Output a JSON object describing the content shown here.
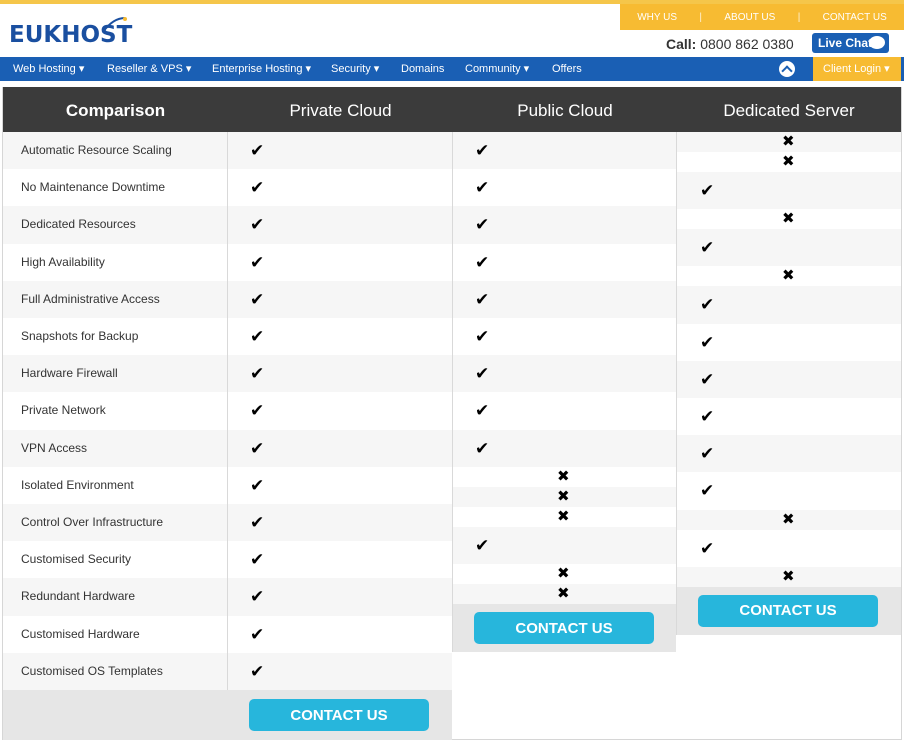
{
  "brand": {
    "logo_text": "EUKHOST"
  },
  "toplinks": [
    "WHY US",
    "ABOUT US",
    "CONTACT US"
  ],
  "call": {
    "label": "Call:",
    "number": "0800 862 0380"
  },
  "livechat": "Live Chat",
  "nav": [
    {
      "label": "Web Hosting",
      "caret": true
    },
    {
      "label": "Reseller & VPS",
      "caret": true
    },
    {
      "label": "Enterprise Hosting",
      "caret": true
    },
    {
      "label": "Security",
      "caret": true
    },
    {
      "label": "Domains",
      "caret": false
    },
    {
      "label": "Community",
      "caret": true
    },
    {
      "label": "Offers",
      "caret": false
    }
  ],
  "client_login": "Client Login",
  "table": {
    "headers": [
      "Comparison",
      "Private Cloud",
      "Public Cloud",
      "Dedicated Server"
    ],
    "features": [
      "Automatic Resource Scaling",
      "No Maintenance Downtime",
      "Dedicated Resources",
      "High Availability",
      "Full Administrative Access",
      "Snapshots for Backup",
      "Hardware Firewall",
      "Private Network",
      "VPN Access",
      "Isolated Environment",
      "Control Over Infrastructure",
      "Customised Security",
      "Redundant Hardware",
      "Customised Hardware",
      "Customised OS Templates"
    ],
    "private_cloud": [
      "yes",
      "yes",
      "yes",
      "yes",
      "yes",
      "yes",
      "yes",
      "yes",
      "yes",
      "yes",
      "yes",
      "yes",
      "yes",
      "yes",
      "yes"
    ],
    "public_cloud": [
      "yes",
      "yes",
      "yes",
      "yes",
      "yes",
      "yes",
      "yes",
      "yes",
      "yes",
      "no",
      "no",
      "no",
      "yes",
      "no",
      "no"
    ],
    "dedicated_server": [
      "no",
      "no",
      "yes",
      "no",
      "yes",
      "no",
      "yes",
      "yes",
      "yes",
      "yes",
      "yes",
      "yes",
      "no",
      "yes",
      "no"
    ],
    "cta_label": "CONTACT US"
  },
  "colors": {
    "nav_blue": "#1a5fb4",
    "accent_yellow": "#f7bb32",
    "header_dark": "#3b3b3b",
    "cta_cyan": "#27b6dc"
  }
}
